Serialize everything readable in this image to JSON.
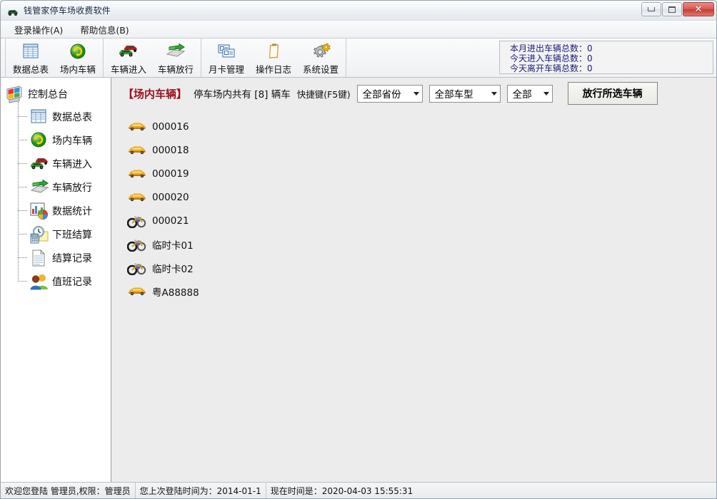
{
  "window": {
    "title": "钱管家停车场收费软件",
    "icon": "car-icon",
    "controls": {
      "minimize": "minimize-icon",
      "maximize": "maximize-icon",
      "close": "✕"
    }
  },
  "menu": {
    "items": [
      {
        "label": "登录操作(A)",
        "name": "menu-login-operations"
      },
      {
        "label": "帮助信息(B)",
        "name": "menu-help-info"
      }
    ]
  },
  "toolbar": {
    "groups": [
      {
        "buttons": [
          {
            "label": "数据总表",
            "icon": "table-icon",
            "name": "toolbar-data-table"
          },
          {
            "label": "场内车辆",
            "icon": "green-refresh-icon",
            "name": "toolbar-vehicles-in-lot"
          }
        ]
      },
      {
        "buttons": [
          {
            "label": "车辆进入",
            "icon": "cars-icon",
            "name": "toolbar-vehicle-entry"
          },
          {
            "label": "车辆放行",
            "icon": "green-arrow-platform-icon",
            "name": "toolbar-vehicle-release"
          }
        ]
      },
      {
        "buttons": [
          {
            "label": "月卡管理",
            "icon": "cards-icon",
            "name": "toolbar-monthly-card"
          },
          {
            "label": "操作日志",
            "icon": "clipboard-icon",
            "name": "toolbar-operation-log"
          },
          {
            "label": "系统设置",
            "icon": "gears-icon",
            "name": "toolbar-system-settings"
          }
        ]
      }
    ],
    "stats": [
      {
        "label": "本月进出车辆总数：",
        "value": "0"
      },
      {
        "label": "今天进入车辆总数：",
        "value": "0"
      },
      {
        "label": "今天离开车辆总数：",
        "value": "0"
      }
    ]
  },
  "sidebar": {
    "root": {
      "label": "控制总台",
      "icon": "console-icon"
    },
    "items": [
      {
        "label": "数据总表",
        "icon": "table-icon",
        "name": "sidebar-item-data-table"
      },
      {
        "label": "场内车辆",
        "icon": "green-refresh-icon",
        "name": "sidebar-item-vehicles-in-lot"
      },
      {
        "label": "车辆进入",
        "icon": "cars-icon",
        "name": "sidebar-item-vehicle-entry"
      },
      {
        "label": "车辆放行",
        "icon": "green-arrow-platform-icon",
        "name": "sidebar-item-vehicle-release"
      },
      {
        "label": "数据统计",
        "icon": "chart-icon",
        "name": "sidebar-item-statistics"
      },
      {
        "label": "下班结算",
        "icon": "clock-calculator-icon",
        "name": "sidebar-item-shift-settlement"
      },
      {
        "label": "结算记录",
        "icon": "document-icon",
        "name": "sidebar-item-settlement-records"
      },
      {
        "label": "值班记录",
        "icon": "users-icon",
        "name": "sidebar-item-duty-records"
      }
    ]
  },
  "content": {
    "title": "【场内车辆】",
    "info": "停车场内共有 [8] 辆车",
    "shortcut": "快捷键(F5键)",
    "filters": [
      {
        "value": "全部省份",
        "name": "filter-province"
      },
      {
        "value": "全部车型",
        "name": "filter-vehicle-type"
      },
      {
        "value": "全部",
        "name": "filter-all"
      }
    ],
    "release_button": "放行所选车辆",
    "vehicles": [
      {
        "plate": "000016",
        "icon": "car-icon"
      },
      {
        "plate": "000018",
        "icon": "car-icon"
      },
      {
        "plate": "000019",
        "icon": "car-icon"
      },
      {
        "plate": "000020",
        "icon": "car-icon"
      },
      {
        "plate": "000021",
        "icon": "motorcycle-icon"
      },
      {
        "plate": "临时卡01",
        "icon": "motorcycle-icon"
      },
      {
        "plate": "临时卡02",
        "icon": "motorcycle-icon"
      },
      {
        "plate": "粤A88888",
        "icon": "car-icon"
      }
    ]
  },
  "statusbar": {
    "welcome": "欢迎您登陆 管理员,权限：管理员",
    "last_login": "您上次登陆时间为：2014-01-1",
    "current_time": "现在时间是：2020-04-03 15:55:31"
  },
  "colors": {
    "title_red": "#9c1320",
    "stats_blue": "#1c1c7a",
    "content_bg": "#ececec",
    "sidebar_bg": "#ffffff"
  }
}
